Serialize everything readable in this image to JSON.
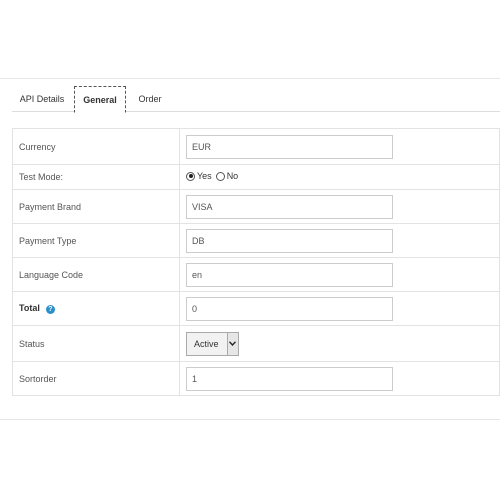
{
  "tabs": [
    {
      "label": "API Details",
      "active": false
    },
    {
      "label": "General",
      "active": true
    },
    {
      "label": "Order",
      "active": false
    }
  ],
  "fields": {
    "currency": {
      "label": "Currency",
      "value": "EUR"
    },
    "test_mode": {
      "label": "Test Mode:",
      "yes_label": "Yes",
      "no_label": "No",
      "selected": "Yes"
    },
    "payment_brand": {
      "label": "Payment Brand",
      "value": "VISA"
    },
    "payment_type": {
      "label": "Payment Type",
      "value": "DB"
    },
    "language_code": {
      "label": "Language Code",
      "value": "en"
    },
    "total": {
      "label": "Total",
      "value": "0",
      "help_icon": "question-circle-icon",
      "help_color": "#2a8fc9"
    },
    "status": {
      "label": "Status",
      "value": "Active"
    },
    "sortorder": {
      "label": "Sortorder",
      "value": "1"
    }
  }
}
